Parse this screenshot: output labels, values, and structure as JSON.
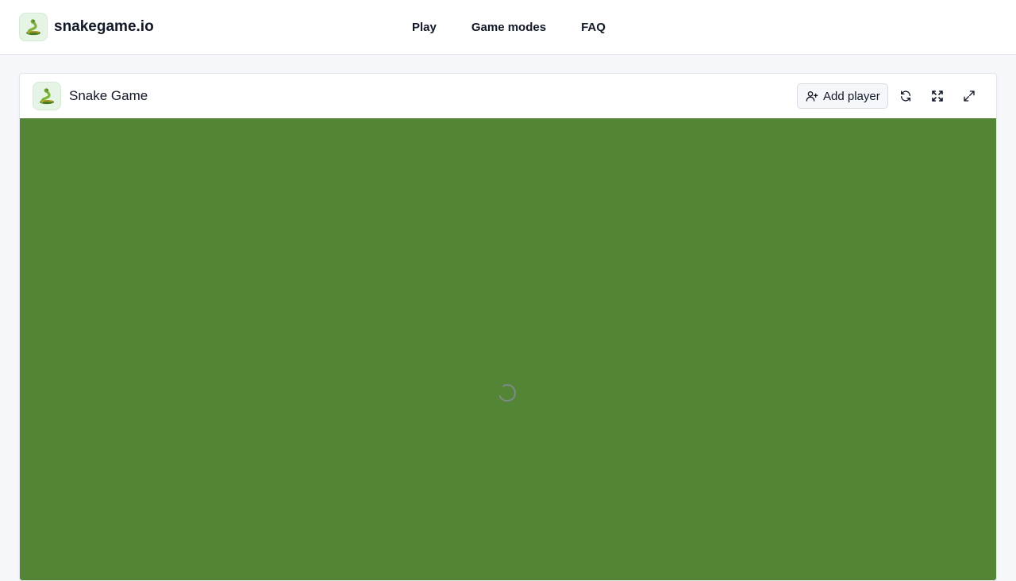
{
  "site": {
    "name": "snakegame.io",
    "logo_icon": "snake-icon"
  },
  "nav": {
    "items": [
      {
        "label": "Play"
      },
      {
        "label": "Game modes"
      },
      {
        "label": "FAQ"
      }
    ]
  },
  "game_panel": {
    "title": "Snake Game",
    "logo_icon": "snake-icon",
    "add_player_label": "Add player",
    "add_player_icon": "user-plus-icon",
    "actions": [
      "refresh-icon",
      "fullscreen-icon",
      "expand-icon"
    ],
    "board_color": "#548536",
    "status": "loading"
  },
  "colors": {
    "page_bg": "#f5f7fb",
    "logo_tile_bg": "#e6f4e6",
    "text": "#111827"
  }
}
